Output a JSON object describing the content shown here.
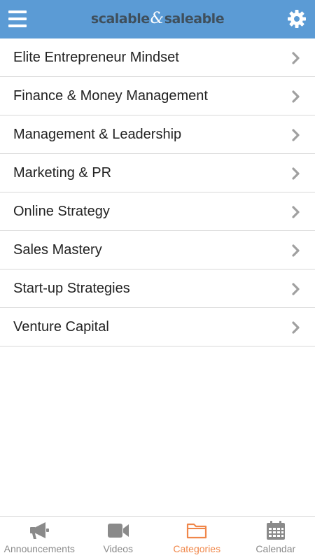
{
  "header": {
    "logo_left": "scalable",
    "logo_amp": "&",
    "logo_right": "saleable",
    "menu_icon": "hamburger-menu-icon",
    "settings_icon": "gear-icon"
  },
  "categories": [
    {
      "label": "Elite Entrepreneur Mindset"
    },
    {
      "label": "Finance & Money Management"
    },
    {
      "label": "Management & Leadership"
    },
    {
      "label": "Marketing & PR"
    },
    {
      "label": "Online Strategy"
    },
    {
      "label": "Sales Mastery"
    },
    {
      "label": "Start-up Strategies"
    },
    {
      "label": "Venture Capital"
    }
  ],
  "tabs": [
    {
      "label": "Announcements",
      "icon": "megaphone-icon",
      "active": false
    },
    {
      "label": "Videos",
      "icon": "video-camera-icon",
      "active": false
    },
    {
      "label": "Categories",
      "icon": "folder-icon",
      "active": true
    },
    {
      "label": "Calendar",
      "icon": "calendar-icon",
      "active": false
    }
  ],
  "colors": {
    "header_bg": "#5b9bd5",
    "active_tab": "#f0874a",
    "inactive_tab": "#8a8a8a",
    "divider": "#d9d9d9"
  }
}
